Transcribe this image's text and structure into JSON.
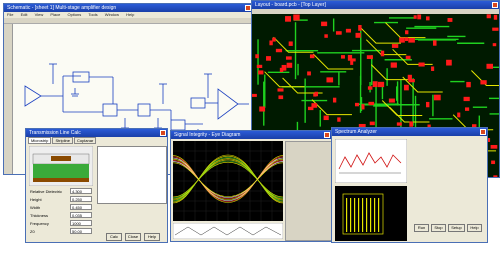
{
  "schematic": {
    "title": "Schematic - [sheet 1] Multi-stage amplifier design",
    "menu": [
      "File",
      "Edit",
      "View",
      "Place",
      "Options",
      "Tools",
      "Window",
      "Help"
    ]
  },
  "pcb": {
    "title": "Layout - board.pcb - [Top Layer]"
  },
  "tline": {
    "title": "Transmission Line Calc",
    "tabs": [
      "Microstrip",
      "Stripline",
      "Coplanar"
    ],
    "fields": [
      {
        "label": "Relative Dielectric",
        "value": "4.300"
      },
      {
        "label": "Height",
        "value": "0.250"
      },
      {
        "label": "Width",
        "value": "0.450"
      },
      {
        "label": "Thickness",
        "value": "0.035"
      },
      {
        "label": "Frequency",
        "value": "1000"
      },
      {
        "label": "Z0",
        "value": "50.00"
      }
    ],
    "buttons": [
      "Calc",
      "Close",
      "Help"
    ]
  },
  "scope": {
    "title": "Signal Integrity - Eye Diagram"
  },
  "analyzer": {
    "title": "Spectrum Analyzer",
    "buttons": [
      "Run",
      "Stop",
      "Setup",
      "Help"
    ]
  },
  "colors": {
    "pcb_bg": "#001a00",
    "trace_green": "#1fd11f",
    "pad_red": "#ff1a1a",
    "trace_yellow": "#e6e600",
    "schematic_wire": "#1a3fc0",
    "title_blue": "#1a3fa8",
    "window_face": "#ece9d8"
  }
}
